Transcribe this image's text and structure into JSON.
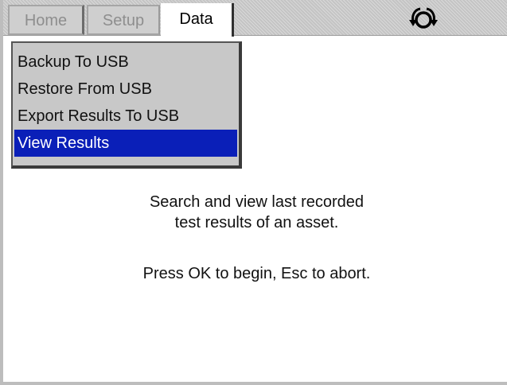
{
  "tabs": [
    {
      "label": "Home",
      "active": false
    },
    {
      "label": "Setup",
      "active": false
    },
    {
      "label": "Data",
      "active": true
    }
  ],
  "status_icon": "rotate-arrows-icon",
  "menu": {
    "items": [
      {
        "label": "Backup To USB",
        "selected": false
      },
      {
        "label": "Restore From USB",
        "selected": false
      },
      {
        "label": "Export Results To USB",
        "selected": false
      },
      {
        "label": "View Results",
        "selected": true
      }
    ]
  },
  "message": {
    "line1": "Search and view last recorded",
    "line2": "test results of an asset.",
    "line3": "Press OK to begin, Esc to abort."
  },
  "colors": {
    "selection": "#0a1fb8",
    "menu_bg": "#c8c8c8",
    "topbar_bg": "#c4c4c4"
  }
}
